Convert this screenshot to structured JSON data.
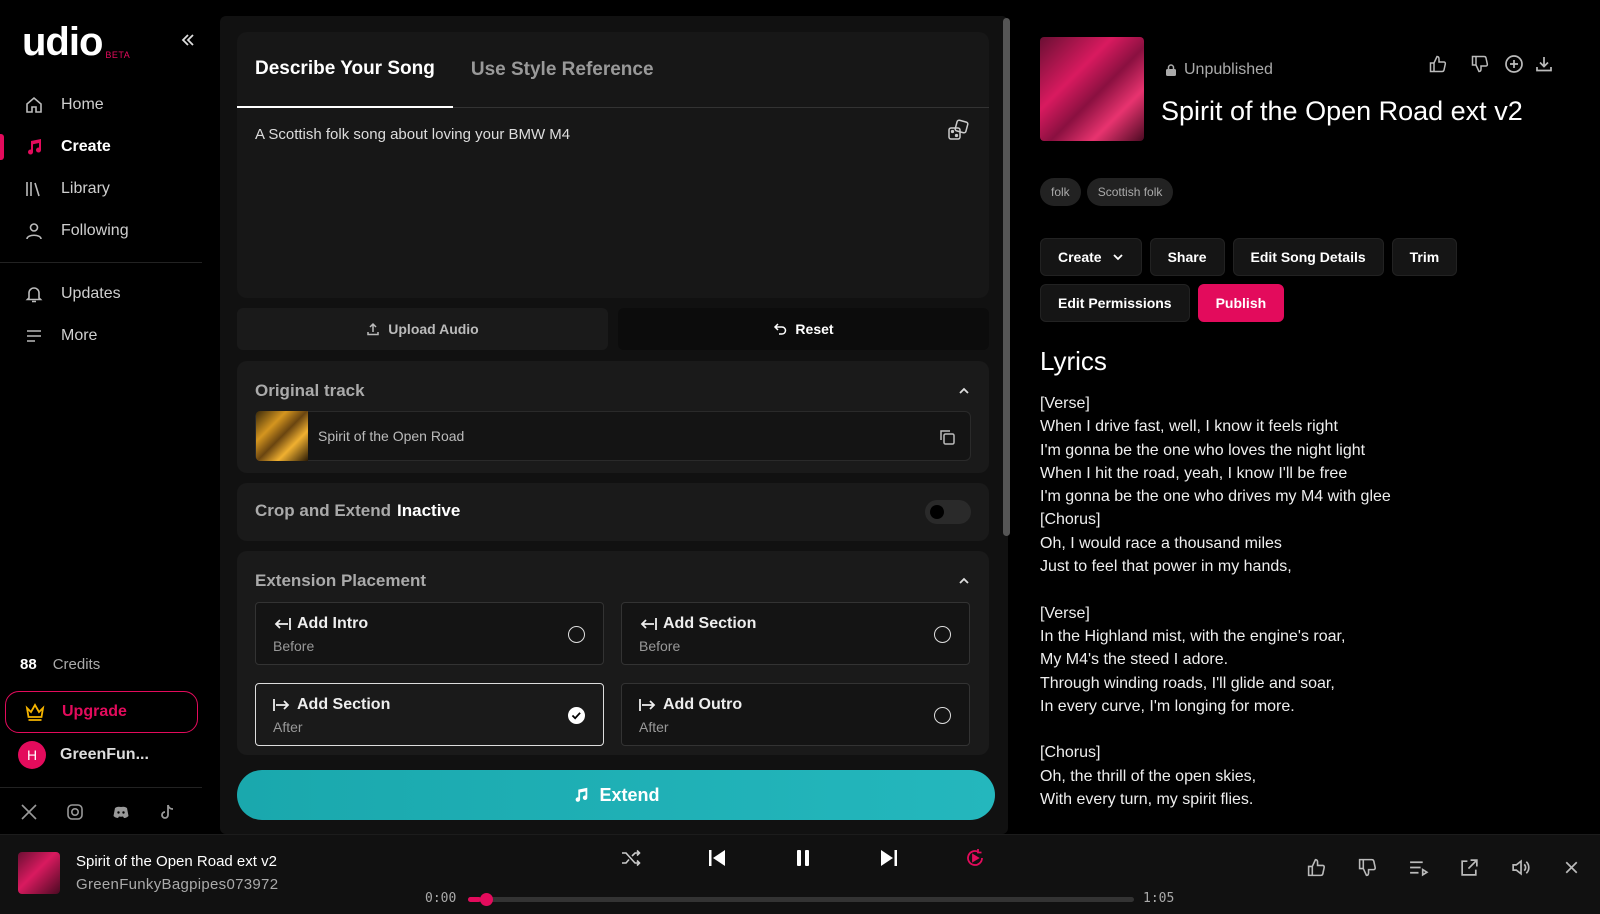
{
  "app": {
    "logo": "udio",
    "beta": "BETA"
  },
  "sidebar": {
    "items": [
      {
        "label": "Home",
        "icon": "home-icon"
      },
      {
        "label": "Create",
        "icon": "music-note-icon",
        "active": true
      },
      {
        "label": "Library",
        "icon": "library-icon"
      },
      {
        "label": "Following",
        "icon": "user-icon"
      },
      {
        "label": "Updates",
        "icon": "bell-icon"
      },
      {
        "label": "More",
        "icon": "menu-icon"
      }
    ],
    "credits_count": "88",
    "credits_label": "Credits",
    "upgrade_label": "Upgrade",
    "user_initial": "H",
    "user_name": "GreenFun..."
  },
  "create": {
    "tabs": [
      "Describe Your Song",
      "Use Style Reference"
    ],
    "prompt": "A Scottish folk song about loving your BMW M4",
    "upload_label": "Upload Audio",
    "reset_label": "Reset",
    "original_track_title": "Original track",
    "original_track_name": "Spirit of the Open Road",
    "crop_label": "Crop and Extend",
    "crop_state": "Inactive",
    "placement_title": "Extension Placement",
    "options": [
      {
        "title": "Add Intro",
        "sub": "Before",
        "selected": false
      },
      {
        "title": "Add Section",
        "sub": "Before",
        "selected": false
      },
      {
        "title": "Add Section",
        "sub": "After",
        "selected": true
      },
      {
        "title": "Add Outro",
        "sub": "After",
        "selected": false
      }
    ],
    "extend_label": "Extend"
  },
  "song": {
    "status": "Unpublished",
    "title": "Spirit of the Open Road ext v2",
    "tags": [
      "folk",
      "Scottish folk"
    ],
    "actions": [
      "Create",
      "Share",
      "Edit Song Details",
      "Trim",
      "Edit Permissions",
      "Publish"
    ],
    "lyrics_heading": "Lyrics",
    "lyrics": "[Verse]\nWhen I drive fast, well, I know it feels right\nI'm gonna be the one who loves the night light\nWhen I hit the road, yeah, I know I'll be free\nI'm gonna be the one who drives my M4 with glee\n[Chorus]\nOh, I would race a thousand miles\nJust to feel that power in my hands,\n\n[Verse]\nIn the Highland mist, with the engine's roar,\nMy M4's the steed I adore.\nThrough winding roads, I'll glide and soar,\nIn every curve, I'm longing for more.\n\n[Chorus]\nOh, the thrill of the open skies,\nWith every turn, my spirit flies."
  },
  "player": {
    "title": "Spirit of the Open Road ext v2",
    "artist": "GreenFunkyBagpipes073972",
    "current_time": "0:00",
    "duration": "1:05",
    "progress_fraction": 0.02
  },
  "colors": {
    "accent": "#e30b5c",
    "extend": "#1fb0b6"
  }
}
